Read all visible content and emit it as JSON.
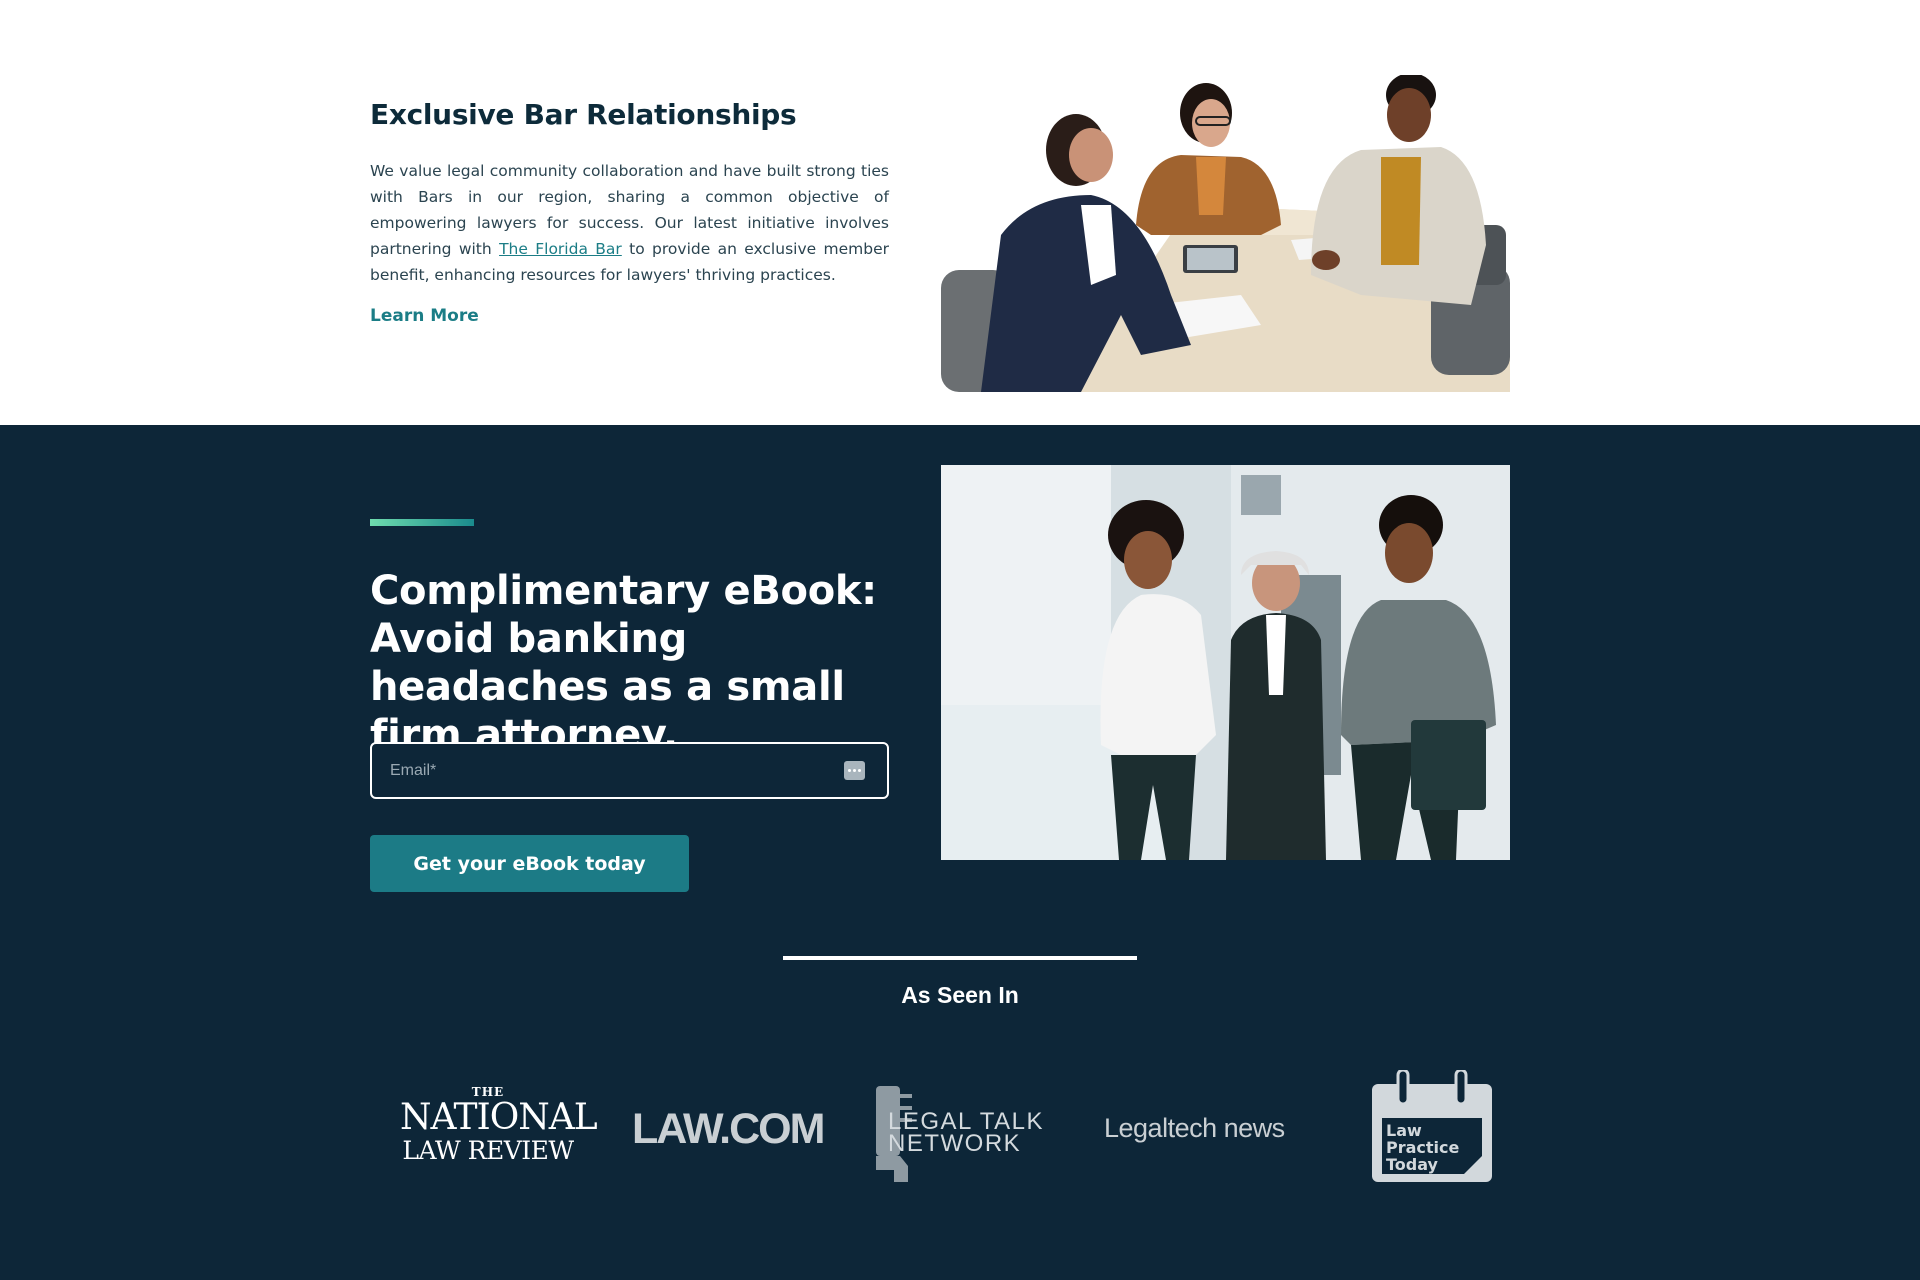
{
  "bar_section": {
    "title": "Exclusive Bar Relationships",
    "body_before_link": "We value legal community collaboration and have built strong ties with Bars in our region, sharing a common objective of empowering lawyers for success. Our latest initiative involves partnering with ",
    "link_text": "The Florida Bar",
    "body_after_link": " to provide an exclusive member benefit, enhancing resources for lawyers' thriving practices.",
    "learn_more": "Learn More",
    "image_icon": "meeting-photo"
  },
  "ebook_section": {
    "title": "Complimentary eBook: Avoid banking headaches as a small firm attorney.",
    "email_placeholder": "Email*",
    "email_value": "",
    "cta_label": "Get your eBook today",
    "image_icon": "team-photo"
  },
  "as_seen_in": {
    "title": "As Seen In",
    "logos": [
      {
        "name": "national-law-review",
        "the": "THE",
        "line1": "NATIONAL",
        "line2": "LAW REVIEW"
      },
      {
        "name": "law-com",
        "text": "LAW.COM"
      },
      {
        "name": "legal-talk-network",
        "line1": "LEGAL TALK",
        "line2": "NETWORK"
      },
      {
        "name": "legaltech-news",
        "text": "Legaltech news"
      },
      {
        "name": "law-practice-today",
        "line1": "Law",
        "line2": "Practice",
        "line3": "Today"
      }
    ]
  },
  "colors": {
    "dark_bg": "#0d2638",
    "accent_teal": "#1c7b86",
    "link_teal": "#1b7d86",
    "accent_gradient_start": "#6fdcae"
  }
}
